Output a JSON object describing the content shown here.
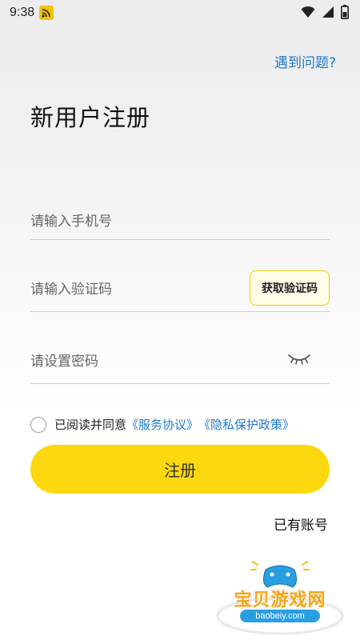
{
  "status_bar": {
    "time": "9:38",
    "app_icon": "rss-icon",
    "right_icons": [
      "wifi-icon",
      "signal-icon",
      "battery-icon"
    ]
  },
  "header": {
    "help_link": "遇到问题?",
    "title": "新用户注册"
  },
  "form": {
    "phone": {
      "placeholder": "请输入手机号",
      "value": ""
    },
    "code": {
      "placeholder": "请输入验证码",
      "value": "",
      "button_label": "获取验证码"
    },
    "password": {
      "placeholder": "请设置密码",
      "value": "",
      "toggle_icon": "eye-closed-icon"
    }
  },
  "agreement": {
    "checked": false,
    "text": "已阅读并同意",
    "terms_link": "《服务协议》",
    "privacy_link": "《隐私保护政策》"
  },
  "actions": {
    "register_label": "注册",
    "login_link": "已有账号"
  },
  "watermark": {
    "title": "宝贝游戏网",
    "url": "baobeiy.com"
  },
  "colors": {
    "accent_yellow": "#fdd80f",
    "link_blue": "#1e78c8"
  }
}
